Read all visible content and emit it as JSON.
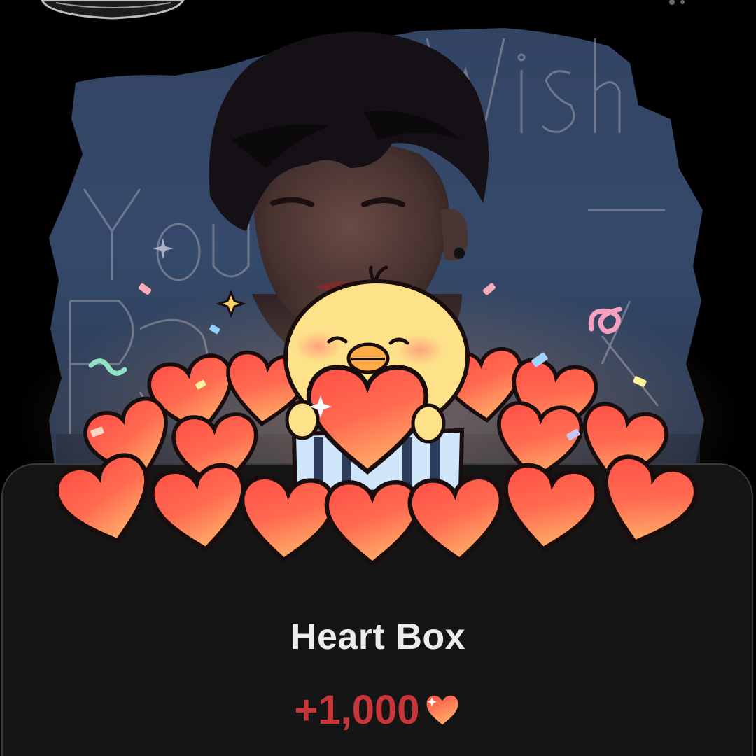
{
  "reward": {
    "title": "Heart Box",
    "amount": "+1,000"
  },
  "icons": {
    "amount_icon": "heart-icon",
    "mascot": "yellow-chick-mascot"
  },
  "colors": {
    "background": "#000000",
    "sheet": "#151515",
    "title_text": "#ececec",
    "amount_text": "#c8363a",
    "heart_fill_top": "#ff5a4a",
    "heart_fill_bottom": "#ffa060",
    "chick": "#fde28a"
  }
}
